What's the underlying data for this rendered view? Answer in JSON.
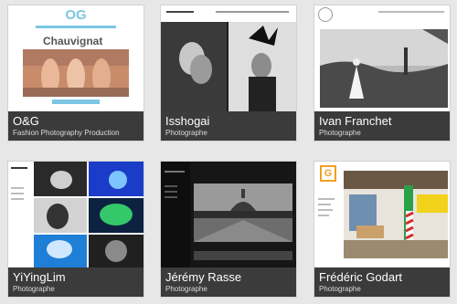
{
  "sites": [
    {
      "name": "O&G",
      "subtitle": "Fashion Photography Production",
      "thumb_logo": "OG",
      "thumb_heading": "Chauvignat"
    },
    {
      "name": "Isshogai",
      "subtitle": "Photographe"
    },
    {
      "name": "Ivan Franchet",
      "subtitle": "Photographe"
    },
    {
      "name": "YiYingLim",
      "subtitle": "Photographe"
    },
    {
      "name": "Jérémy Rasse",
      "subtitle": "Photographe"
    },
    {
      "name": "Frédéric Godart",
      "subtitle": "Photographe",
      "thumb_logo": "G"
    }
  ],
  "colors": {
    "caption_bg": "#3b3b3b",
    "page_bg": "#e7e7e7",
    "og_blue": "#7cc6e4",
    "godart_orange": "#f0a020"
  }
}
